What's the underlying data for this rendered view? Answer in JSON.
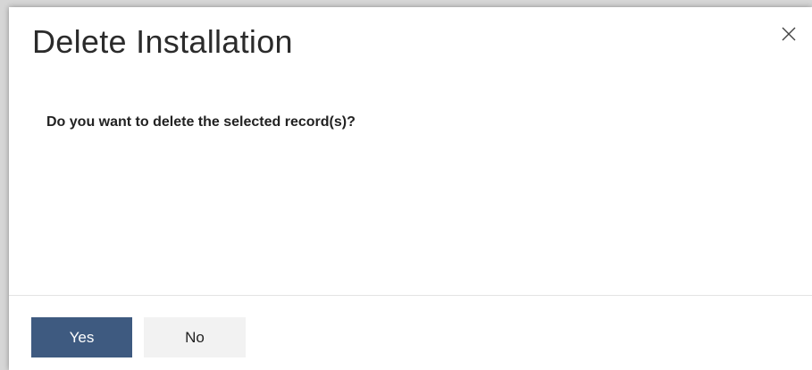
{
  "dialog": {
    "title": "Delete Installation",
    "close_icon": "close-icon",
    "message": "Do you want to delete the selected record(s)?",
    "buttons": {
      "yes_label": "Yes",
      "no_label": "No"
    }
  },
  "colors": {
    "primary_button": "#3e5a80",
    "secondary_button": "#f2f2f2",
    "title_text": "#2b2b2b"
  }
}
